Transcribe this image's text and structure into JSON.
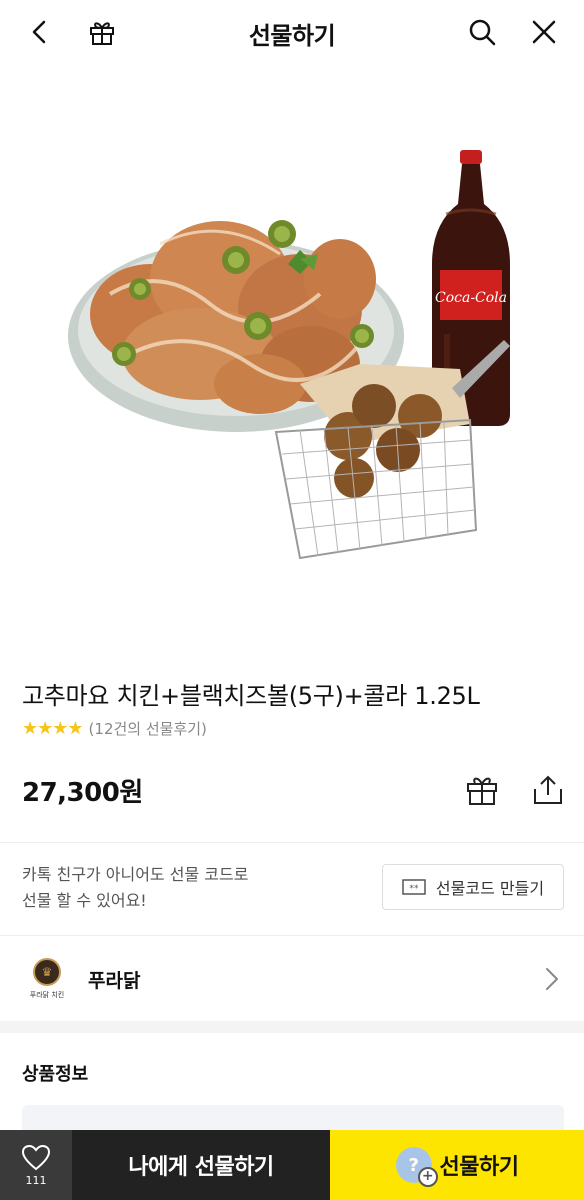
{
  "header": {
    "title": "선물하기",
    "back_icon": "chevron-left-icon",
    "gift_icon": "gift-icon",
    "search_icon": "search-icon",
    "close_icon": "close-icon"
  },
  "product": {
    "title": "고추마요 치킨+블랙치즈볼(5구)+콜라 1.25L",
    "stars": "★★★★",
    "rating_value": 4,
    "review_text": "(12건의 선물후기)",
    "price": "27,300원",
    "bottle_label": "Coca-Cola"
  },
  "gift_code": {
    "description_line1": "카톡 친구가 아니어도 선물 코드로",
    "description_line2": "선물 할 수 있어요!",
    "button_label": "선물코드 만들기",
    "button_icon_text": "**"
  },
  "brand": {
    "name": "푸라닭",
    "logo_text": "푸라닭 치킨"
  },
  "details": {
    "section_title": "상품정보"
  },
  "bottom_bar": {
    "like_count": "111",
    "self_gift_label": "나에게 선물하기",
    "gift_label": "선물하기",
    "gift_badge_text": "?"
  },
  "colors": {
    "accent_yellow": "#fee500",
    "star": "#f5c518",
    "dark_button": "#222222"
  }
}
